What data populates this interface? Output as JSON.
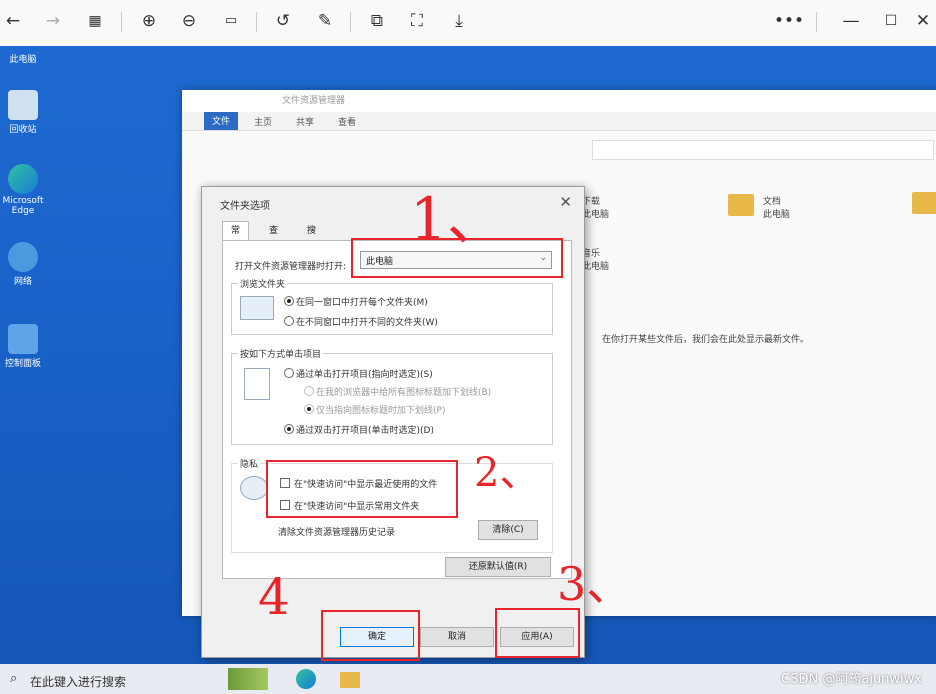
{
  "toolbar": {
    "icons": [
      "back-arrow-icon",
      "forward-arrow-icon",
      "grid-icon",
      "zoom-in-icon",
      "zoom-out-icon",
      "actual-size-icon",
      "rotate-icon",
      "edit-icon",
      "crop-icon",
      "fit-icon",
      "save-icon",
      "more-icon",
      "minimize-icon",
      "maximize-icon",
      "close-icon"
    ]
  },
  "desktop": {
    "icons": [
      {
        "label": "此电脑"
      },
      {
        "label": "回收站"
      },
      {
        "label": "Microsoft Edge"
      },
      {
        "label": "网络"
      },
      {
        "label": "控制面板"
      }
    ]
  },
  "explorer": {
    "title": "文件资源管理器",
    "ribbon_tabs": [
      "文件",
      "主页",
      "共享",
      "查看"
    ],
    "items": [
      {
        "name": "下载",
        "sub": "此电脑"
      },
      {
        "name": "文档",
        "sub": "此电脑"
      },
      {
        "name": "音乐",
        "sub": "此电脑"
      }
    ],
    "recent_text": "在你打开某些文件后，我们会在此处显示最新文件。"
  },
  "dialog": {
    "title": "文件夹选项",
    "close": "✕",
    "tabs": [
      "常规",
      "查看",
      "搜索"
    ],
    "open_label": "打开文件资源管理器时打开:",
    "open_value": "此电脑",
    "browse": {
      "title": "浏览文件夹",
      "options": [
        "在同一窗口中打开每个文件夹(M)",
        "在不同窗口中打开不同的文件夹(W)"
      ]
    },
    "click": {
      "title": "按如下方式单击项目",
      "options": [
        "通过单击打开项目(指向时选定)(S)",
        "在我的浏览器中给所有图标标题加下划线(B)",
        "仅当指向图标标题时加下划线(P)",
        "通过双击打开项目(单击时选定)(D)"
      ]
    },
    "privacy": {
      "title": "隐私",
      "options": [
        "在\"快速访问\"中显示最近使用的文件",
        "在\"快速访问\"中显示常用文件夹"
      ],
      "clear_label": "清除文件资源管理器历史记录",
      "clear_button": "清除(C)"
    },
    "restore_button": "还原默认值(R)",
    "ok_button": "确定",
    "cancel_button": "取消",
    "apply_button": "应用(A)"
  },
  "annotations": [
    "1、",
    "2、",
    "3、",
    "4"
  ],
  "taskbar": {
    "search_placeholder": "在此键入进行搜索"
  },
  "watermark": "CSDN @阿筠ajunwiwx",
  "colors": {
    "annotation": "#e8252a",
    "desktop": "#1a62c9",
    "ribbon_file": "#2b6bc4"
  }
}
